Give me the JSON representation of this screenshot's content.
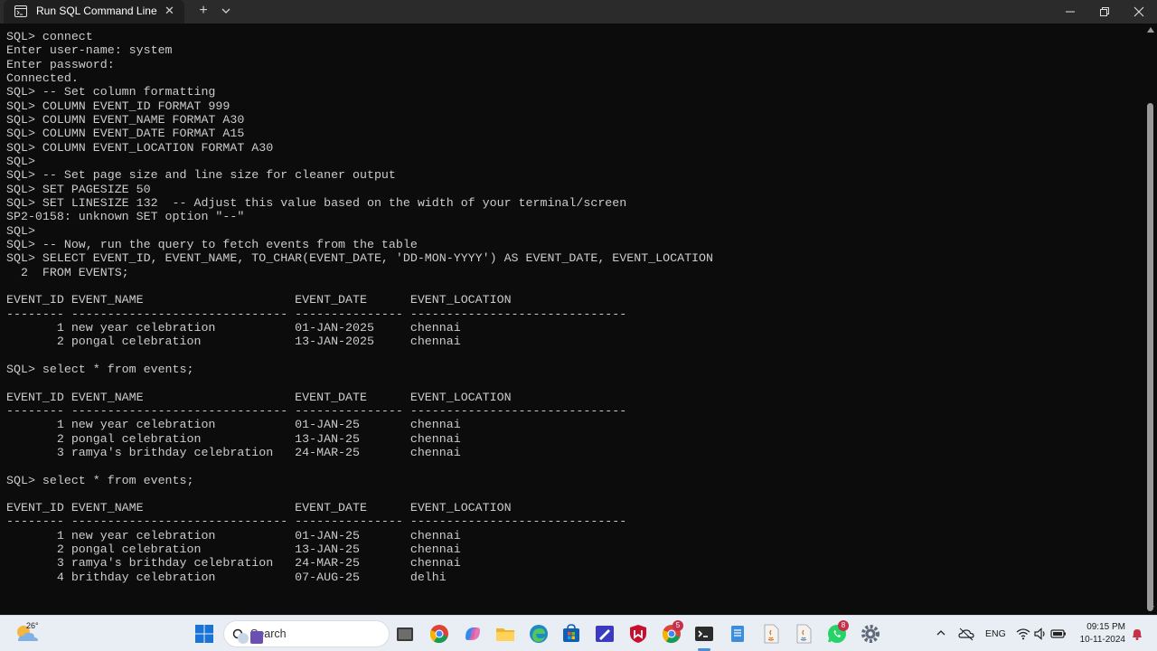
{
  "window": {
    "tab_title": "Run SQL Command Line",
    "new_tab_symbol": "+",
    "close_symbol": "✕"
  },
  "terminal": {
    "lines": [
      "SQL> connect",
      "Enter user-name: system",
      "Enter password:",
      "Connected.",
      "SQL> -- Set column formatting",
      "SQL> COLUMN EVENT_ID FORMAT 999",
      "SQL> COLUMN EVENT_NAME FORMAT A30",
      "SQL> COLUMN EVENT_DATE FORMAT A15",
      "SQL> COLUMN EVENT_LOCATION FORMAT A30",
      "SQL>",
      "SQL> -- Set page size and line size for cleaner output",
      "SQL> SET PAGESIZE 50",
      "SQL> SET LINESIZE 132  -- Adjust this value based on the width of your terminal/screen",
      "SP2-0158: unknown SET option \"--\"",
      "SQL>",
      "SQL> -- Now, run the query to fetch events from the table",
      "SQL> SELECT EVENT_ID, EVENT_NAME, TO_CHAR(EVENT_DATE, 'DD-MON-YYYY') AS EVENT_DATE, EVENT_LOCATION",
      "  2  FROM EVENTS;",
      "",
      "EVENT_ID EVENT_NAME                     EVENT_DATE      EVENT_LOCATION",
      "-------- ------------------------------ --------------- ------------------------------",
      "       1 new year celebration           01-JAN-2025     chennai",
      "       2 pongal celebration             13-JAN-2025     chennai",
      "",
      "SQL> select * from events;",
      "",
      "EVENT_ID EVENT_NAME                     EVENT_DATE      EVENT_LOCATION",
      "-------- ------------------------------ --------------- ------------------------------",
      "       1 new year celebration           01-JAN-25       chennai",
      "       2 pongal celebration             13-JAN-25       chennai",
      "       3 ramya's brithday celebration   24-MAR-25       chennai",
      "",
      "SQL> select * from events;",
      "",
      "EVENT_ID EVENT_NAME                     EVENT_DATE      EVENT_LOCATION",
      "-------- ------------------------------ --------------- ------------------------------",
      "       1 new year celebration           01-JAN-25       chennai",
      "       2 pongal celebration             13-JAN-25       chennai",
      "       3 ramya's brithday celebration   24-MAR-25       chennai",
      "       4 brithday celebration           07-AUG-25       delhi"
    ]
  },
  "taskbar": {
    "weather_temp": "26°",
    "search_placeholder": "Search",
    "chrome_badge": "5",
    "whatsapp_badge": "8",
    "language": "ENG",
    "time": "09:15 PM",
    "date": "10-11-2024"
  },
  "colors": {
    "terminal_bg": "#0c0c0c",
    "terminal_text": "#cccccc",
    "tabbar_bg": "#2b2b2b",
    "taskbar_bg": "#e9eef4",
    "accent": "#4a8fd6"
  }
}
